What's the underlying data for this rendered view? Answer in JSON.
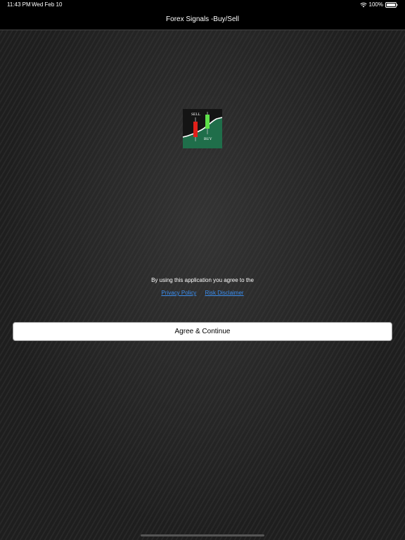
{
  "status_bar": {
    "time": "11:43 PM",
    "date": "Wed Feb 10",
    "battery": "100%"
  },
  "nav": {
    "title": "Forex Signals -Buy/Sell"
  },
  "logo": {
    "sell_label": "SELL",
    "buy_label": "BUY",
    "icon": "candlestick-logo-icon"
  },
  "consent": {
    "text": "By using this application you agree to the",
    "privacy_link": "Privacy Policy",
    "risk_link": "Risk Disclaimer"
  },
  "button": {
    "agree_label": "Agree & Continue"
  },
  "colors": {
    "link": "#3a8ef0",
    "sell_candle": "#e0201a",
    "buy_candle": "#5ee04a",
    "logo_green": "#1f6e4a"
  }
}
